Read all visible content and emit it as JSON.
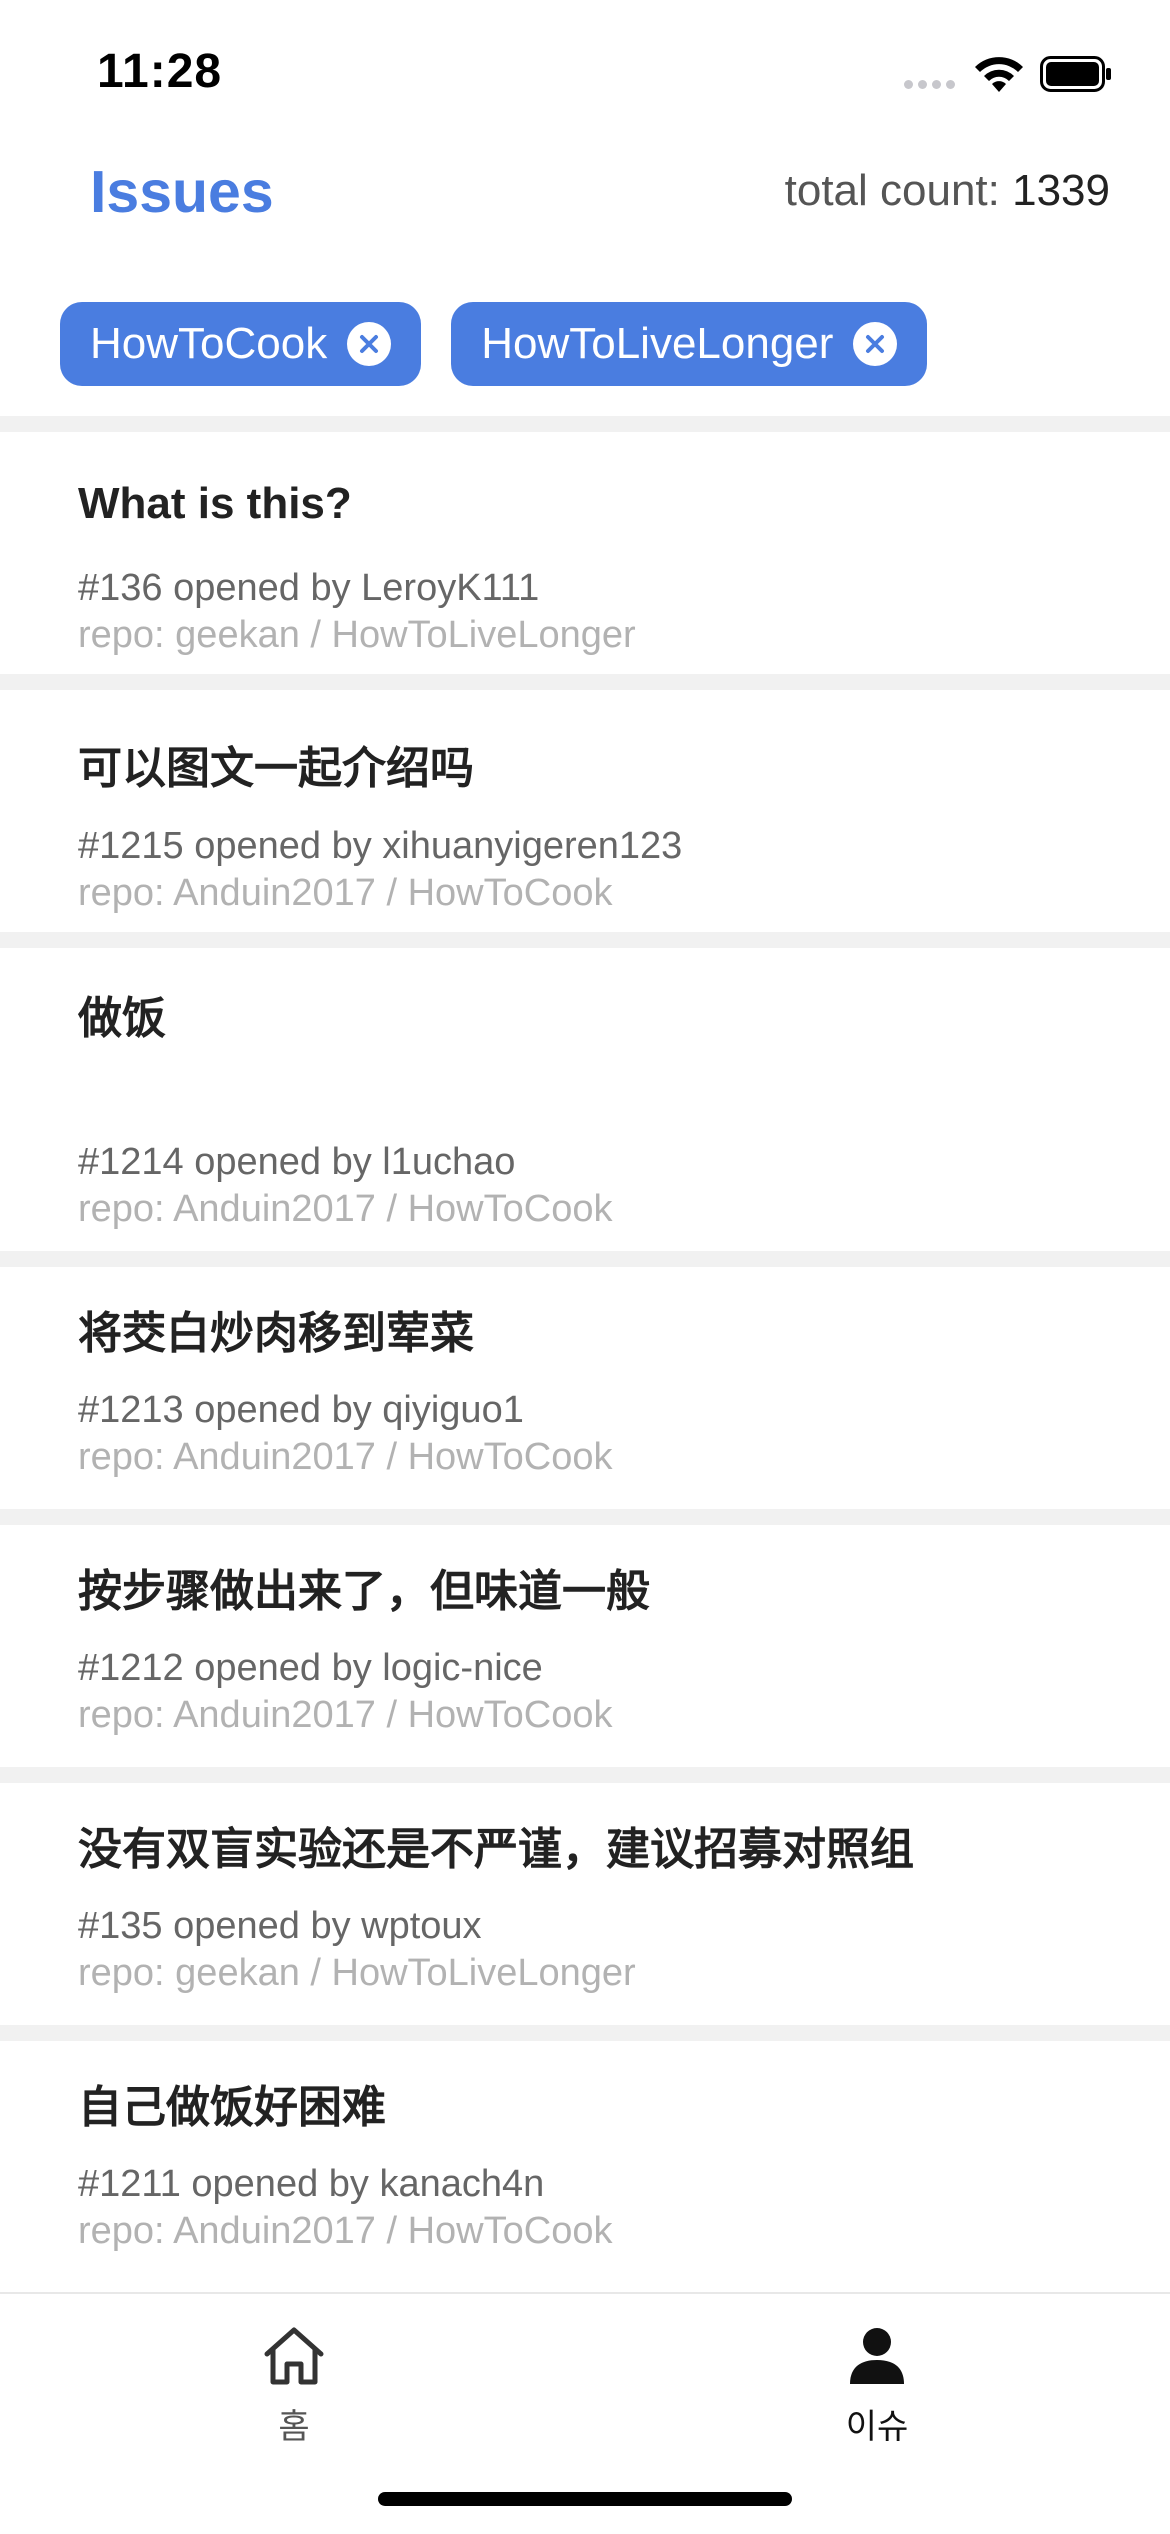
{
  "status": {
    "time": "11:28"
  },
  "header": {
    "title": "Issues",
    "total_label": "total count: ",
    "total_value": "1339"
  },
  "filters": [
    {
      "label": "HowToCook",
      "icon": "close-circle-icon"
    },
    {
      "label": "HowToLiveLonger",
      "icon": "close-circle-icon"
    }
  ],
  "issues": [
    {
      "title": "What is this?",
      "meta": "#136 opened by LeroyK111",
      "repo": "repo: geekan / HowToLiveLonger"
    },
    {
      "title": "可以图文一起介绍吗",
      "meta": "#1215 opened by xihuanyigeren123",
      "repo": "repo: Anduin2017 / HowToCook"
    },
    {
      "title": "做饭",
      "meta": "#1214 opened by l1uchao",
      "repo": "repo: Anduin2017 / HowToCook"
    },
    {
      "title": "将茭白炒肉移到荤菜",
      "meta": "#1213 opened by qiyiguo1",
      "repo": "repo: Anduin2017 / HowToCook"
    },
    {
      "title": "按步骤做出来了，但味道一般",
      "meta": "#1212 opened by logic-nice",
      "repo": "repo: Anduin2017 / HowToCook"
    },
    {
      "title": "没有双盲实验还是不严谨，建议招募对照组",
      "meta": "#135 opened by wptoux",
      "repo": "repo: geekan / HowToLiveLonger"
    },
    {
      "title": "自己做饭好困难",
      "meta": "#1211 opened by kanach4n",
      "repo": "repo: Anduin2017 / HowToCook"
    }
  ],
  "tabs": [
    {
      "label": "홈",
      "icon": "home-icon"
    },
    {
      "label": "이슈",
      "icon": "person-icon"
    }
  ],
  "colors": {
    "accent": "#4a7de0",
    "separator": "#f1f1f1"
  }
}
